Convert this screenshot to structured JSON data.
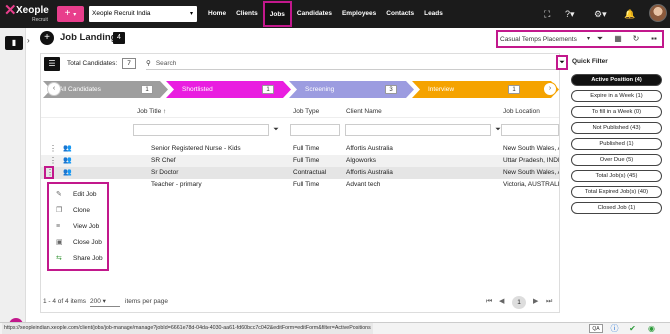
{
  "topbar": {
    "logo_text": "Xeople",
    "logo_sub": "Recruit",
    "org_select": "Xeople Recruit India",
    "nav": [
      "Home",
      "Clients",
      "Jobs",
      "Candidates",
      "Employees",
      "Contacts",
      "Leads"
    ],
    "active_nav": "Jobs"
  },
  "page": {
    "title": "Job Landing",
    "count": "4",
    "view_select": "Casual Temps Placements"
  },
  "grid": {
    "total_label": "Total Candidates:",
    "total_count": "7",
    "search_placeholder": "Search",
    "stages": [
      {
        "label": "All Candidates",
        "count": "1",
        "color": "#9e9e9e"
      },
      {
        "label": "Shortlisted",
        "count": "1",
        "color": "#e91ee0"
      },
      {
        "label": "Screening",
        "count": "3",
        "color": "#9c9ce0"
      },
      {
        "label": "Interview",
        "count": "1",
        "color": "#f5a300"
      }
    ],
    "columns": [
      "Job Title",
      "Job Type",
      "Client Name",
      "Job Location"
    ],
    "rows": [
      {
        "title": "Senior Registered Nurse - Kids",
        "type": "Full Time",
        "client": "Affortis Australia",
        "location": "New South Wales, AU"
      },
      {
        "title": "SR Chef",
        "type": "Full Time",
        "client": "Algoworks",
        "location": "Uttar Pradesh, INDIA"
      },
      {
        "title": "Sr Doctor",
        "type": "Contractual",
        "client": "Affortis Australia",
        "location": "New South Wales, AU"
      },
      {
        "title": "Teacher - primary",
        "type": "Full Time",
        "client": "Advant tech",
        "location": "Victoria, AUSTRALIA"
      }
    ],
    "context_menu": [
      {
        "label": "Edit Job",
        "icon": "pencil-icon"
      },
      {
        "label": "Clone",
        "icon": "clone-icon"
      },
      {
        "label": "View Job",
        "icon": "list-icon"
      },
      {
        "label": "Close Job",
        "icon": "briefcase-icon"
      },
      {
        "label": "Share Job",
        "icon": "share-icon"
      }
    ],
    "pager": {
      "range": "1 - 4 of 4 items",
      "page_size": "200",
      "page_size_label": "items per page",
      "current_page": "1"
    }
  },
  "quick_filter": {
    "title": "Quick Filter",
    "items": [
      "Active Position (4)",
      "Expire in a Week (1)",
      "To fill in a Week (0)",
      "Not Published (43)",
      "Published (1)",
      "Over Due (5)",
      "Total Job(s) (45)",
      "Total Expired Job(s) (40)",
      "Closed Job (1)"
    ],
    "active_index": 0
  },
  "statusbar": {
    "url": "https://xeopleindian.xeople.com/client/jobs/job-manage/manage?jobId=6661e78d-04da-4030-aa61-fd60bcc7c042&editForm=editForm&filter=ActivePositions",
    "qa": "QA"
  },
  "colors": {
    "accent": "#c2188c",
    "brand_pink": "#e83e8c",
    "topbar": "#1b1b1b"
  }
}
